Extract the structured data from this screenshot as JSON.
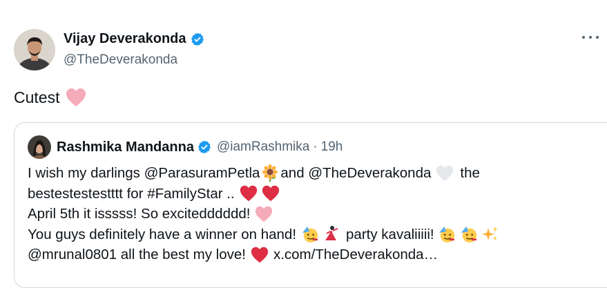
{
  "tweet": {
    "author_name": "Vijay Deverakonda",
    "author_handle": "@TheDeverakonda",
    "text": "Cutest",
    "text_emoji": "pink-heart"
  },
  "quote": {
    "author_name": "Rashmika Mandanna",
    "author_handle": "@iamRashmika",
    "separator": "·",
    "time": "19h",
    "lines": [
      {
        "segments": [
          "I wish my darlings  @ParasuramPetla",
          "and @TheDeverakonda",
          "the"
        ],
        "emojis": [
          "sunflower",
          "white-heart"
        ]
      },
      {
        "segments": [
          "bestestestestttt for #FamilyStar .."
        ],
        "emojis": [
          "red-heart",
          "red-heart"
        ]
      },
      {
        "segments": [
          "April 5th it isssss! So excitedddddd!"
        ],
        "emojis": [
          "pink-heart"
        ]
      },
      {
        "segments": [
          "You guys definitely have a winner on hand!",
          "party kavaliiiii!"
        ],
        "emojis": [
          "partying-face",
          "dancer",
          "partying-face",
          "partying-face",
          "sparkles"
        ]
      },
      {
        "segments": [
          "@mrunal0801 all the best my love!",
          "x.com/TheDeverakonda…"
        ],
        "emojis": [
          "red-heart"
        ]
      }
    ]
  },
  "colors": {
    "text": "#0f1419",
    "secondary": "#536471",
    "verified": "#1d9bf0",
    "border": "#cfd9de"
  }
}
